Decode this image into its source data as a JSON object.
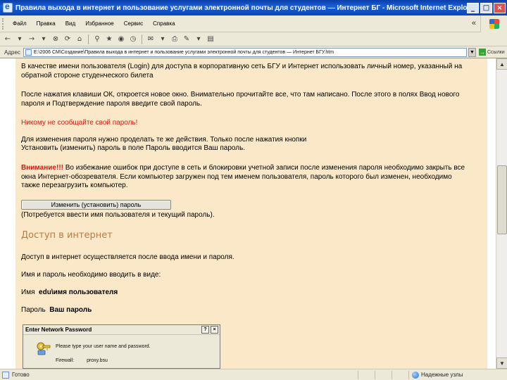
{
  "window": {
    "title": "Правила выхода в интернет и пользование услугами электронной почты для студентов — Интернет БГ - Microsoft Internet Explorer",
    "minimize": "_",
    "maximize": "□",
    "close": "×"
  },
  "menu": {
    "items": [
      "Файл",
      "Правка",
      "Вид",
      "Избранное",
      "Сервис",
      "Справка"
    ]
  },
  "address": {
    "label": "Адрес",
    "value": "E:\\2006 СМ\\Создание\\Правила выхода в интернет и пользование услугами электронной почты для студентов — Интернет БГУ.htm",
    "go_label": "Ссылки"
  },
  "content": {
    "para1": "В качестве имени пользователя (Login) для доступа в корпоративную сеть БГУ и Интернет использовать личный номер, указанный на обратной стороне студенческого билета",
    "para2": "После нажатия клавиши ОК, откроется новое окно. Внимательно прочитайте все, что там написано. После этого в полях Ввод нового пароля и Подтверждение пароля введите свой пароль.",
    "warning": "Никому не сообщайте свой пароль!",
    "para3_line1": "Для изменения пароля нужно проделать те же действия. Только после нажатия кнопки",
    "para3_line2": "Установить (изменить) пароль в поле Пароль вводится Ваш пароль.",
    "attention_label": "Внимание!!!",
    "attention_text": " Во избежание ошибок при доступе в сеть и блокировки учетной записи после изменения пароля необходимо закрыть все окна Интернет-обозревателя. Если компьютер загружен под тем именем пользователя, пароль которого был изменен, необходимо также перезагрузить компьютер.",
    "change_button": "Изменить (установить) пароль",
    "change_note": "(Потребуется ввести имя пользователя и текущий пароль).",
    "heading": "Доступ в интернет",
    "para4": "Доступ в интернет осуществляется после ввода имени и пароля.",
    "para5": "Имя и пароль необходимо вводить в виде:",
    "name_label": "Имя",
    "name_value": "edu\\имя пользователя",
    "password_label": "Пароль",
    "password_value": "Ваш пароль"
  },
  "dialog": {
    "title": "Enter Network Password",
    "help": "?",
    "close": "×",
    "prompt": "Please type your user name and password.",
    "site_label": "Firewall:",
    "site_value": "proxy.bsu"
  },
  "status": {
    "text": "Готово",
    "zone": "Надежные узлы"
  },
  "toolbar": {
    "icons": [
      "back-icon",
      "forward-icon",
      "stop-icon",
      "refresh-icon",
      "home-icon",
      "search-icon",
      "favorites-icon",
      "media-icon",
      "history-icon",
      "mail-icon",
      "print-icon",
      "edit-icon",
      "discuss-icon"
    ]
  }
}
